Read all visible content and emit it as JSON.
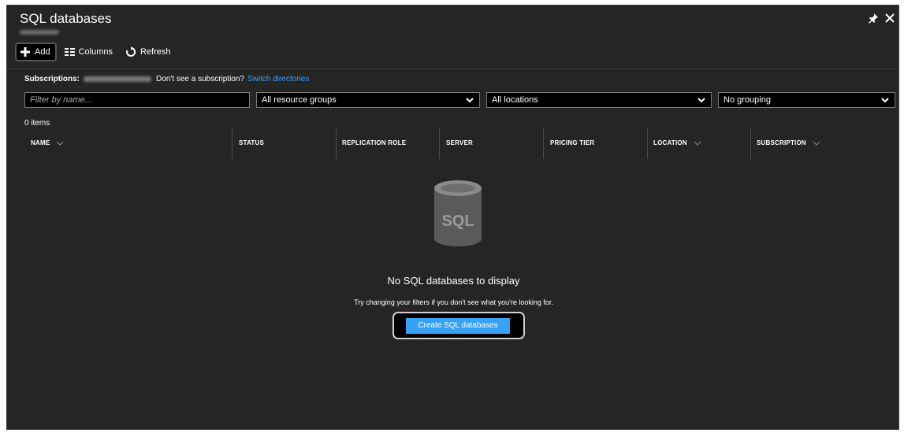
{
  "blade": {
    "title": "SQL databases",
    "pin_icon": "pin-icon",
    "close_icon": "close-icon"
  },
  "toolbar": {
    "add_label": "Add",
    "columns_label": "Columns",
    "refresh_label": "Refresh"
  },
  "subscriptions": {
    "label": "Subscriptions:",
    "question": "Don't see a subscription?",
    "link": "Switch directories"
  },
  "filters": {
    "name_placeholder": "Filter by name...",
    "resource_groups": "All resource groups",
    "locations": "All locations",
    "grouping": "No grouping"
  },
  "list": {
    "count": "0 items",
    "columns": [
      "NAME",
      "STATUS",
      "REPLICATION ROLE",
      "SERVER",
      "PRICING TIER",
      "LOCATION",
      "SUBSCRIPTION"
    ]
  },
  "empty_state": {
    "icon_text": "SQL",
    "title": "No SQL databases to display",
    "hint": "Try changing your filters if you don't see what you're looking for.",
    "button": "Create SQL databases"
  },
  "colors": {
    "background": "#252526",
    "accent": "#36a2f5",
    "link": "#3aa0ff"
  }
}
